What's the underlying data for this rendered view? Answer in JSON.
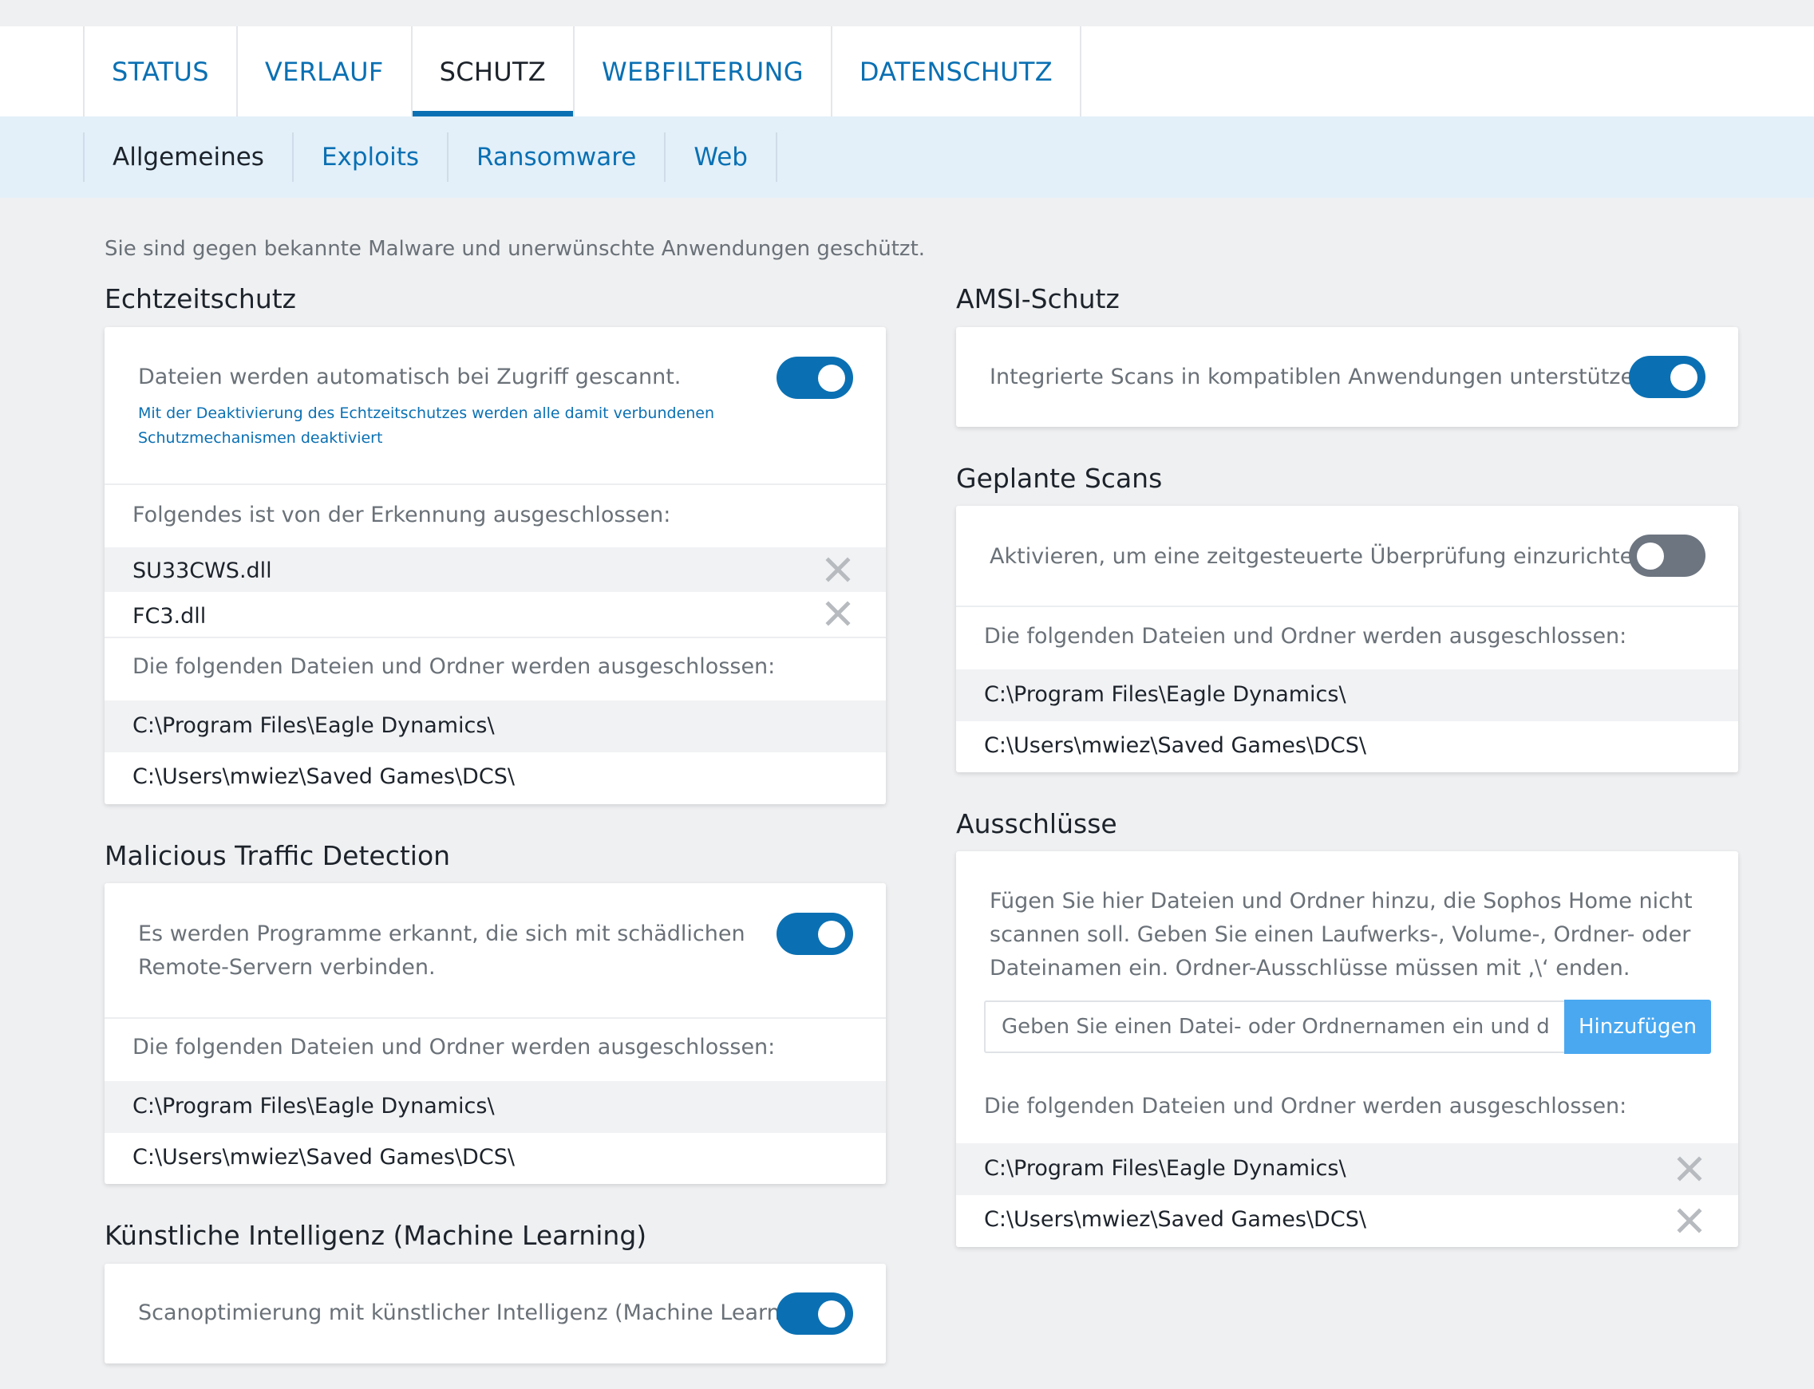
{
  "tabs": [
    "STATUS",
    "VERLAUF",
    "SCHUTZ",
    "WEBFILTERUNG",
    "DATENSCHUTZ"
  ],
  "active_tab": "SCHUTZ",
  "subtabs": [
    "Allgemeines",
    "Exploits",
    "Ransomware",
    "Web"
  ],
  "active_subtab": "Allgemeines",
  "intro": "Sie sind gegen bekannte Malware und unerwünschte Anwendungen geschützt.",
  "echtzeit": {
    "title": "Echtzeitschutz",
    "description": "Dateien werden automatisch bei Zugriff gescannt.",
    "warning_line1": "Mit der Deaktivierung des Echtzeitschutzes werden alle damit verbundenen",
    "warning_line2": "Schutzmechanismen deaktiviert",
    "enabled": true,
    "detection_label": "Folgendes ist von der Erkennung ausgeschlossen:",
    "detections": [
      "SU33CWS.dll",
      "FC3.dll"
    ],
    "files_label": "Die folgenden Dateien und Ordner werden ausgeschlossen:",
    "files": [
      "C:\\Program Files\\Eagle Dynamics\\",
      "C:\\Users\\mwiez\\Saved Games\\DCS\\"
    ]
  },
  "traffic": {
    "title": "Malicious Traffic Detection",
    "description_line1": "Es werden Programme erkannt, die sich mit schädlichen",
    "description_line2": "Remote-Servern verbinden.",
    "enabled": true,
    "files_label": "Die folgenden Dateien und Ordner werden ausgeschlossen:",
    "files": [
      "C:\\Program Files\\Eagle Dynamics\\",
      "C:\\Users\\mwiez\\Saved Games\\DCS\\"
    ]
  },
  "ml": {
    "title": "Künstliche Intelligenz (Machine Learning)",
    "description": "Scanoptimierung mit künstlicher Intelligenz (Machine Learning).",
    "enabled": true
  },
  "amsi": {
    "title": "AMSI-Schutz",
    "description": "Integrierte Scans in kompatiblen Anwendungen unterstützen.",
    "enabled": true
  },
  "scans": {
    "title": "Geplante Scans",
    "description": "Aktivieren, um eine zeitgesteuerte Überprüfung einzurichten.",
    "enabled": false,
    "files_label": "Die folgenden Dateien und Ordner werden ausgeschlossen:",
    "files": [
      "C:\\Program Files\\Eagle Dynamics\\",
      "C:\\Users\\mwiez\\Saved Games\\DCS\\"
    ]
  },
  "excl": {
    "title": "Ausschlüsse",
    "help_line1": "Fügen Sie hier Dateien und Ordner hinzu, die Sophos Home nicht",
    "help_line2": "scannen soll. Geben Sie einen Laufwerks-, Volume-, Ordner- oder",
    "help_line3": "Dateinamen ein. Ordner-Ausschlüsse müssen mit ‚\\‘ enden.",
    "input_placeholder": "Geben Sie einen Datei- oder Ordnernamen ein und drücken Sie die Eingabetaste",
    "add_label": "Hinzufügen",
    "files_label": "Die folgenden Dateien und Ordner werden ausgeschlossen:",
    "files": [
      "C:\\Program Files\\Eagle Dynamics\\",
      "C:\\Users\\mwiez\\Saved Games\\DCS\\"
    ]
  },
  "colors": {
    "accent": "#0a70b3",
    "toggle_off": "#6d7580",
    "add_button": "#49a8f0",
    "subnav_bg": "#e3f0f9",
    "page_bg": "#eff0f2"
  },
  "icons": {
    "remove": "close-x-icon"
  }
}
